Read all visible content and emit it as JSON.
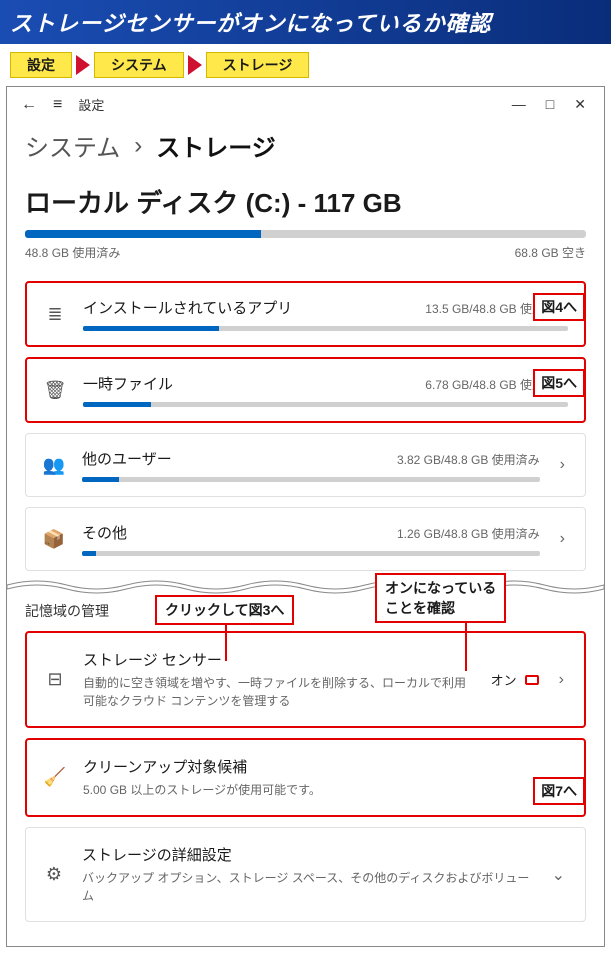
{
  "banner": "ストレージセンサーがオンになっているか確認",
  "crumbs": [
    "設定",
    "システム",
    "ストレージ"
  ],
  "window": {
    "back": "←",
    "menu": "≡",
    "title": "設定",
    "min": "—",
    "max": "□",
    "close": "✕"
  },
  "breadcrumb": {
    "parent": "システム",
    "sep": "›",
    "current": "ストレージ"
  },
  "disk": {
    "title": "ローカル ディスク (C:) - 117 GB",
    "used_label": "48.8 GB 使用済み",
    "free_label": "68.8 GB 空き",
    "fill_pct": 42
  },
  "categories": [
    {
      "icon": "list",
      "name": "インストールされているアプリ",
      "usage": "13.5 GB/48.8 GB 使用済み",
      "fill": 28,
      "hl": true,
      "tag": "図4へ",
      "chevron": false
    },
    {
      "icon": "trash",
      "name": "一時ファイル",
      "usage": "6.78 GB/48.8 GB 使用済み",
      "fill": 14,
      "hl": true,
      "tag": "図5へ",
      "chevron": false
    },
    {
      "icon": "users",
      "name": "他のユーザー",
      "usage": "3.82 GB/48.8 GB 使用済み",
      "fill": 8,
      "hl": false,
      "tag": "",
      "chevron": true
    },
    {
      "icon": "box",
      "name": "その他",
      "usage": "1.26 GB/48.8 GB 使用済み",
      "fill": 3,
      "hl": false,
      "tag": "",
      "chevron": true
    }
  ],
  "section_title": "記憶域の管理",
  "callouts": {
    "click_fig3": "クリックして図3へ",
    "confirm_on": "オンになっている\nことを確認"
  },
  "mgmt": [
    {
      "icon": "disk",
      "title": "ストレージ センサー",
      "desc": "自動的に空き領域を増やす、一時ファイルを削除する、ローカルで利用可能なクラウド コンテンツを管理する",
      "toggle_label": "オン",
      "hl": true,
      "tag": ""
    },
    {
      "icon": "broom",
      "title": "クリーンアップ対象候補",
      "desc": "5.00 GB 以上のストレージが使用可能です。",
      "hl": true,
      "tag": "図7へ"
    },
    {
      "icon": "gear",
      "title": "ストレージの詳細設定",
      "desc": "バックアップ オプション、ストレージ スペース、その他のディスクおよびボリューム",
      "hl": false,
      "tag": ""
    }
  ],
  "icons": {
    "list": "≣",
    "trash": "🗑",
    "users": "👥",
    "box": "📦",
    "disk": "⊟",
    "broom": "🧹",
    "gear": "⚙",
    "chevron": "›",
    "chevron_down": "⌄"
  }
}
